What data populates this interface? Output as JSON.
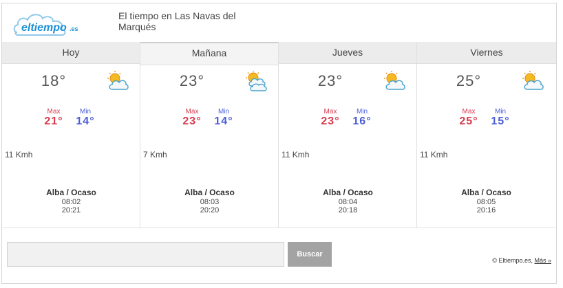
{
  "header": {
    "logo_text": "eltiempo.es",
    "place": "El tiempo en Las Navas del Marqués"
  },
  "days": [
    {
      "name": "Hoy",
      "temp": "18°",
      "icon": "sun-cloud-icon",
      "max_label": "Max",
      "max": "21°",
      "min_label": "Min",
      "min": "14°",
      "wind": "11 Kmh",
      "sun_title": "Alba / Ocaso",
      "sunrise": "08:02",
      "sunset": "20:21"
    },
    {
      "name": "Mañana",
      "temp": "23°",
      "icon": "sun-clouds-icon",
      "max_label": "Max",
      "max": "23°",
      "min_label": "Min",
      "min": "14°",
      "wind": "7 Kmh",
      "sun_title": "Alba / Ocaso",
      "sunrise": "08:03",
      "sunset": "20:20"
    },
    {
      "name": "Jueves",
      "temp": "23°",
      "icon": "sun-cloud-icon",
      "max_label": "Max",
      "max": "23°",
      "min_label": "Min",
      "min": "16°",
      "wind": "11 Kmh",
      "sun_title": "Alba / Ocaso",
      "sunrise": "08:04",
      "sunset": "20:18"
    },
    {
      "name": "Viernes",
      "temp": "25°",
      "icon": "sun-cloud-icon",
      "max_label": "Max",
      "max": "25°",
      "min_label": "Min",
      "min": "15°",
      "wind": "11 Kmh",
      "sun_title": "Alba / Ocaso",
      "sunrise": "08:05",
      "sunset": "20:16"
    }
  ],
  "footer": {
    "search_value": "",
    "search_button": "Buscar",
    "copyright": "© Eltiempo.es,",
    "more_link": "Más »"
  },
  "colors": {
    "max": "#d83a4e",
    "min": "#4a5cd6",
    "logo_blue": "#1b8fd6",
    "button": "#a3a3a3"
  }
}
